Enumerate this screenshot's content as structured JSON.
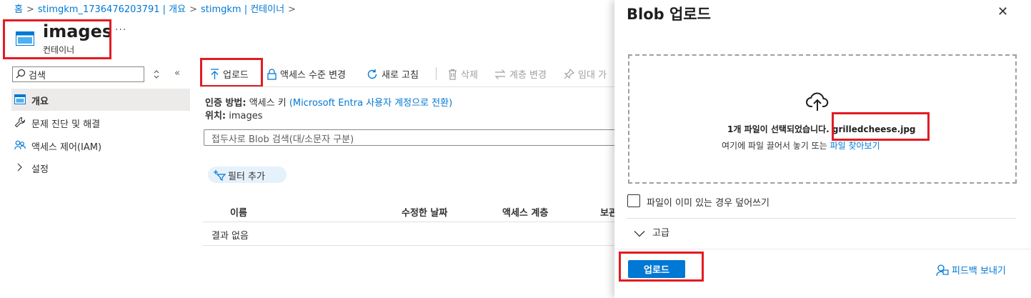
{
  "breadcrumb": [
    "홈",
    "stimgkm_1736476203791 | 개요",
    "stimgkm | 컨테이너"
  ],
  "breadcrumb_sep": ">",
  "header": {
    "title": "images",
    "subtitle": "컨테이너",
    "more": "···"
  },
  "sidebar": {
    "search_placeholder": "검색",
    "collapse": "«",
    "items": [
      {
        "label": "개요",
        "icon": "container-icon",
        "selected": true
      },
      {
        "label": "문제 진단 및 해결",
        "icon": "wrench-icon"
      },
      {
        "label": "액세스 제어(IAM)",
        "icon": "people-icon"
      },
      {
        "label": "설정",
        "icon": "chevron-right-icon"
      }
    ]
  },
  "toolbar": {
    "upload": "업로드",
    "access_level": "액세스 수준 변경",
    "refresh": "새로 고침",
    "delete": "삭제",
    "change_tier": "계층 변경",
    "lease": "임대 가"
  },
  "info": {
    "auth_label": "인증 방법:",
    "auth_value": "액세스 키",
    "auth_link": "(Microsoft Entra 사용자 계정으로 전환)",
    "location_label": "위치:",
    "location_value": "images"
  },
  "blob_search_placeholder": "접두사로 Blob 검색(대/소문자 구분)",
  "filter_button": "필터 추가",
  "table": {
    "columns": [
      "이름",
      "수정한 날짜",
      "액세스 계층",
      "보관"
    ],
    "empty": "결과 없음"
  },
  "panel": {
    "title": "Blob 업로드",
    "close": "✕",
    "selected_text": "1개 파일이 선택되었습니다. grilledcheese.jpg",
    "hint_text": "여기에 파일 끌어서 놓기 또는",
    "browse_link": "파일 찾아보기",
    "overwrite_label": "파일이 이미 있는 경우 덮어쓰기",
    "advanced_label": "고급",
    "upload_button": "업로드",
    "feedback_link": "피드백 보내기"
  },
  "colors": {
    "accent": "#0078d4",
    "highlight": "#e31b23"
  }
}
